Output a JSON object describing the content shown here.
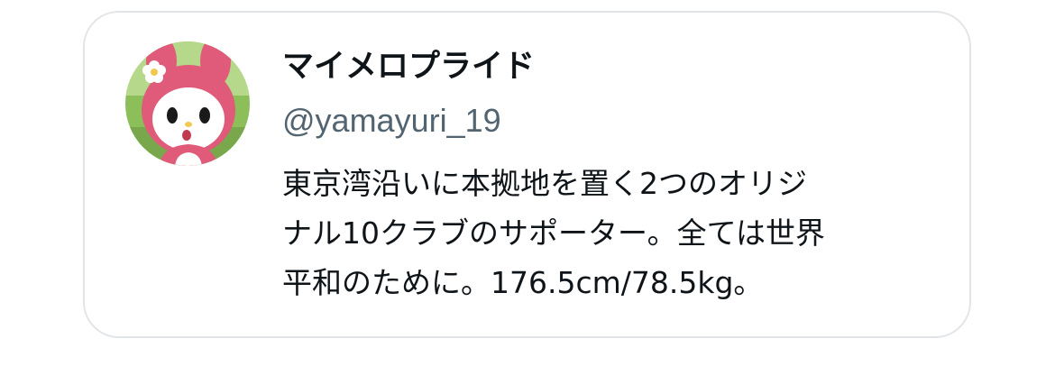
{
  "profile": {
    "display_name": "マイメロプライド",
    "handle": "@yamayuri_19",
    "avatar_icon": "my-melody-avatar-icon",
    "bio_lines": [
      "東京湾沿いに本拠地を置く2つのオリジ",
      "ナル10クラブのサポーター。全ては世界",
      "平和のために。176.5cm/78.5kg。"
    ]
  },
  "colors": {
    "text_primary": "#0f1419",
    "text_secondary": "#536471",
    "card_border": "#e2e5e8",
    "avatar_hood": "#e05a7a"
  }
}
